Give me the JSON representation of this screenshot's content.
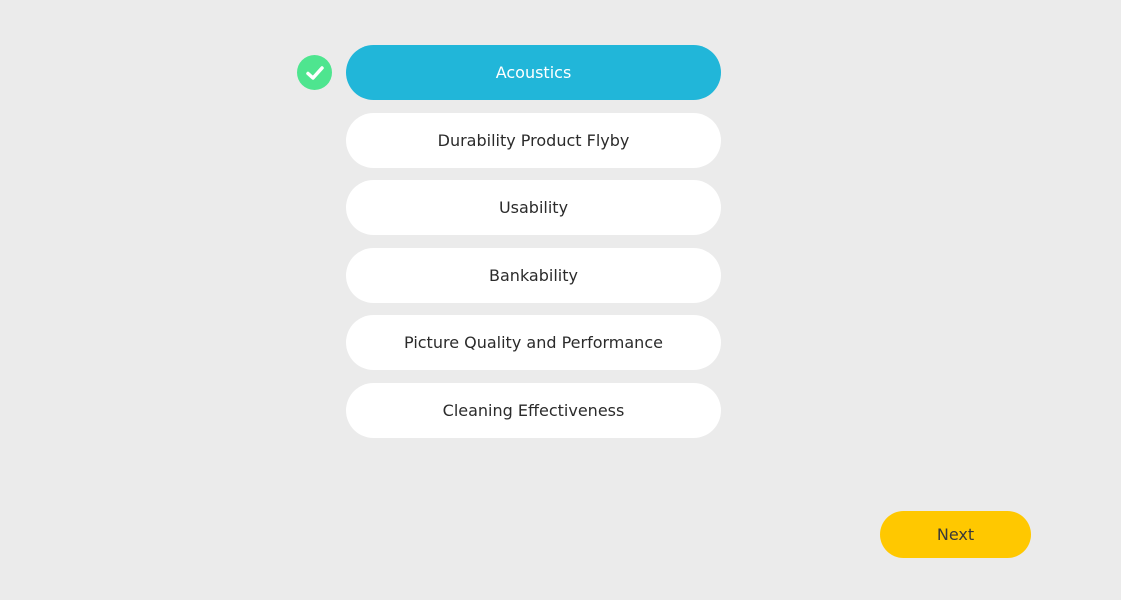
{
  "options": [
    {
      "label": "Acoustics",
      "selected": true
    },
    {
      "label": "Durability Product Flyby",
      "selected": false
    },
    {
      "label": "Usability",
      "selected": false
    },
    {
      "label": "Bankability",
      "selected": false
    },
    {
      "label": "Picture Quality and Performance",
      "selected": false
    },
    {
      "label": "Cleaning Effectiveness",
      "selected": false
    }
  ],
  "selected_indicator_icon": "checkmark-circle-icon",
  "next_button": {
    "label": "Next"
  },
  "colors": {
    "background": "#ebebeb",
    "selected_option": "#21b6d9",
    "option": "#ffffff",
    "check": "#4ee58f",
    "next_button": "#ffc800"
  }
}
